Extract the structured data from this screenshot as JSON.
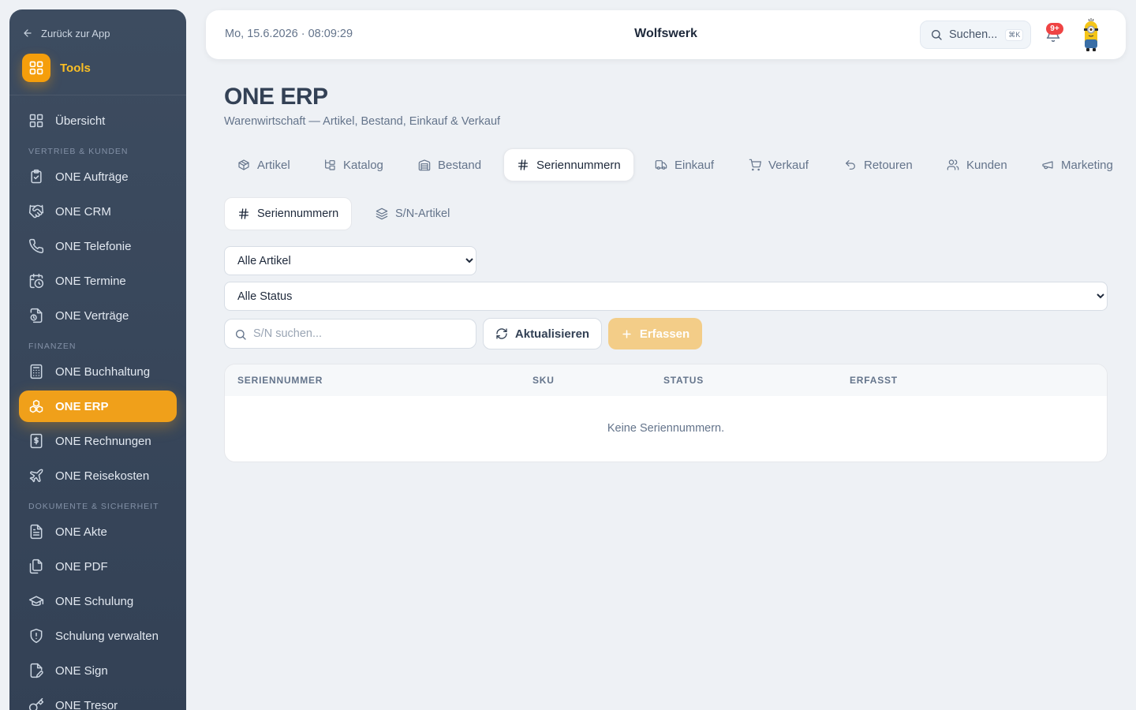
{
  "sidebar": {
    "back_label": "Zurück zur App",
    "tools_label": "Tools",
    "overview_label": "Übersicht",
    "sections": {
      "vertrieb": "VERTRIEB & KUNDEN",
      "finanzen": "FINANZEN",
      "dokumente": "DOKUMENTE & SICHERHEIT"
    },
    "items": {
      "auftraege": "ONE Aufträge",
      "crm": "ONE CRM",
      "telefonie": "ONE Telefonie",
      "termine": "ONE Termine",
      "vertraege": "ONE Verträge",
      "buchhaltung": "ONE Buchhaltung",
      "erp": "ONE ERP",
      "rechnungen": "ONE Rechnungen",
      "reisekosten": "ONE Reisekosten",
      "akte": "ONE Akte",
      "pdf": "ONE PDF",
      "schulung": "ONE Schulung",
      "schulung_verwalten": "Schulung verwalten",
      "sign": "ONE Sign",
      "tresor": "ONE Tresor"
    },
    "active_item": "ONE ERP"
  },
  "header": {
    "datetime": "Mo, 15.6.2026 · 08:09:29",
    "brand": "Wolfswerk",
    "search_label": "Suchen...",
    "search_shortcut": "⌘K",
    "notification_badge": "9+"
  },
  "page": {
    "title": "ONE ERP",
    "subtitle": "Warenwirtschaft — Artikel, Bestand, Einkauf & Verkauf"
  },
  "tabs": {
    "artikel": "Artikel",
    "katalog": "Katalog",
    "bestand": "Bestand",
    "seriennummern": "Seriennummern",
    "einkauf": "Einkauf",
    "verkauf": "Verkauf",
    "retouren": "Retouren",
    "kunden": "Kunden",
    "marketing": "Marketing",
    "active": "Seriennummern"
  },
  "subtabs": {
    "seriennummern": "Seriennummern",
    "sn_artikel": "S/N-Artikel"
  },
  "filters": {
    "artikel_selected": "Alle Artikel",
    "status_selected": "Alle Status",
    "search_placeholder": "S/N suchen...",
    "refresh_label": "Aktualisieren",
    "add_label": "Erfassen"
  },
  "table": {
    "columns": [
      "SERIENNUMMER",
      "SKU",
      "STATUS",
      "ERFASST"
    ],
    "rows": [],
    "empty_message": "Keine Seriennummern."
  },
  "colors": {
    "accent": "#f0a01a",
    "sidebar_bg": "#334155",
    "badge": "#ef4444"
  }
}
